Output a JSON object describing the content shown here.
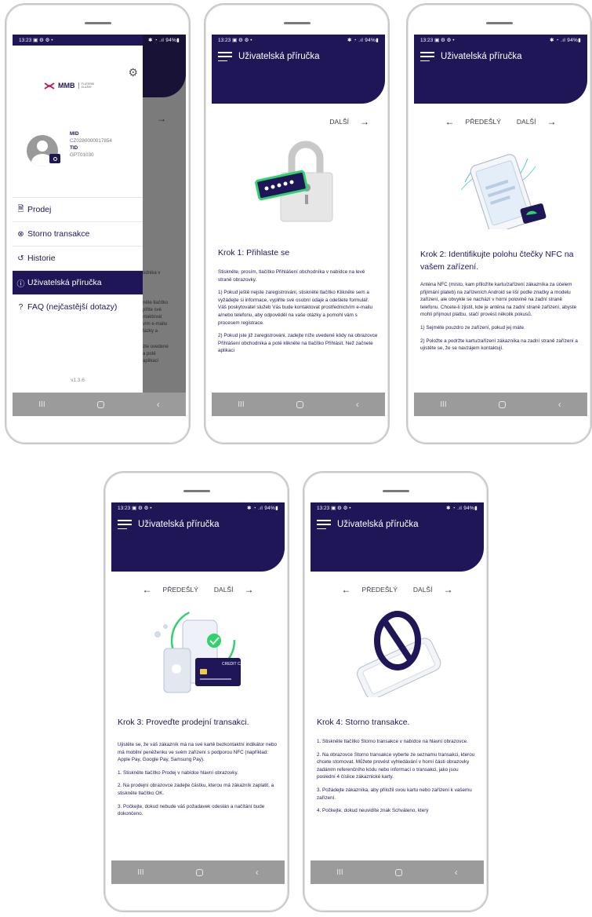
{
  "status": {
    "time": "13:23",
    "indicators": "▣ ⚙ ⚙ •",
    "right": "✱ ◔ .ıl 94%▮"
  },
  "app_title": "Uživatelská příručka",
  "nav": {
    "prev": "PŘEDEŠLÝ",
    "next": "DALŠÍ"
  },
  "system_nav": {
    "recents": "III",
    "back": "‹"
  },
  "drawer": {
    "logo": "MMB",
    "logo_sub": "PLATEBNÍ SLUŽBY",
    "mid_label": "MID",
    "mid_value": "CZ0280000017854",
    "tid_label": "TID",
    "tid_value": "GPT01030",
    "items": [
      {
        "label": "Prodej",
        "icon": "receipt-icon"
      },
      {
        "label": "Storno transakce",
        "icon": "cancel-circle-icon"
      },
      {
        "label": "Historie",
        "icon": "history-icon"
      },
      {
        "label": "Uživatelská příručka",
        "icon": "info-icon"
      },
      {
        "label": "FAQ (nejčastější dotazy)",
        "icon": "question-icon"
      }
    ],
    "version": "v1.3.6",
    "bg_fragments": [
      "odnika v",
      "něte tlačítko",
      "plňte své",
      "ntaktovat",
      "vím e-mailu",
      "tázky a",
      "zte uvedené",
      "a poté",
      "aplikaci"
    ]
  },
  "step1": {
    "title": "Krok 1: Přihlaste se",
    "paragraphs": [
      "Stiskněte, prosím, tlačítko Přihlášení obchodníka v nabídce na levé straně obrazovky.",
      "1) Pokud ještě nejste zaregistrováni, stiskněte tlačítko Klikněte sem a vyžádejte si informace, vyplňte své osobní údaje a odešlete formulář. Váš poskytovatel služeb Vás bude kontaktovat prostřednictvím e-mailu a/nebo telefonu, aby odpověděl na vaše otázky a pomohl vám s procesem registrace.",
      "2) Pokud jste již zaregistrováni, zadejte níže uvedené kódy na obrazovce Přihlášení obchodníka a poté klikněte na tlačítko Přihlásit. Než začnete aplikaci"
    ]
  },
  "step2": {
    "title": "Krok 2: Identifikujte polohu čtečky NFC na vašem zařízení.",
    "paragraphs": [
      "Anténa NFC (místo, kam přiložíte kartu/zařízení zákazníka za účelem přijímání plateb) na zařízeních Android se liší podle značky a modelu zařízení, ale obvykle se nachází v horní polovině na zadní straně telefonu. Chcete-li zjistit, kde je anténa na zadní straně zařízení, abyste mohli přijmout platbu, stačí provést několik pokusů.",
      "1) Sejměte pouzdro ze zařízení, pokud jej máte.",
      "2) Položte a podržte kartu/zařízení zákazníka na zadní straně zařízení a ujistěte se, že se navzájem kontaktují."
    ]
  },
  "step3": {
    "title": "Krok 3: Proveďte prodejní transakci.",
    "card_label": "CREDIT CARD",
    "paragraphs": [
      "Ujistěte se, že váš zákazník má na své kartě bezkontaktní indikátor nebo má mobilní peněženku ve svém zařízení s podporou NFC (například: Apple Pay, Google Pay, Samsung Pay).",
      "1. Stiskněte tlačítko Prodej v nabídce hlavní obrazovky.",
      "2. Na prodejní obrazovce zadejte částku, kterou má zákazník zaplatit, a stiskněte tlačítko OK.",
      "3. Počkejte, dokud nebude váš požadavek odeslán a načítání bude dokončeno."
    ]
  },
  "step4": {
    "title": "Krok 4: Storno transakce.",
    "paragraphs": [
      "1. Stiskněte tlačítko Storno transakce v nabídce na hlavní obrazovce.",
      "2. Na obrazovce Storno transakce vyberte ze seznamu transakci, kterou chcete stornovat. Můžete provést vyhledávání v horní části obrazovky zadáním referenčního kódu nebo informací o transakci, jako jsou poslední 4 číslice zákaznické karty.",
      "3. Požádejte zákazníka, aby přiložil svou kartu nebo zařízení k vašemu zařízení.",
      "4. Počkejte, dokud neuvidíte znak Schváleno, který"
    ]
  },
  "colors": {
    "primary": "#1e1657",
    "accent_green": "#2fd36b",
    "teal": "#4fc3d8"
  }
}
